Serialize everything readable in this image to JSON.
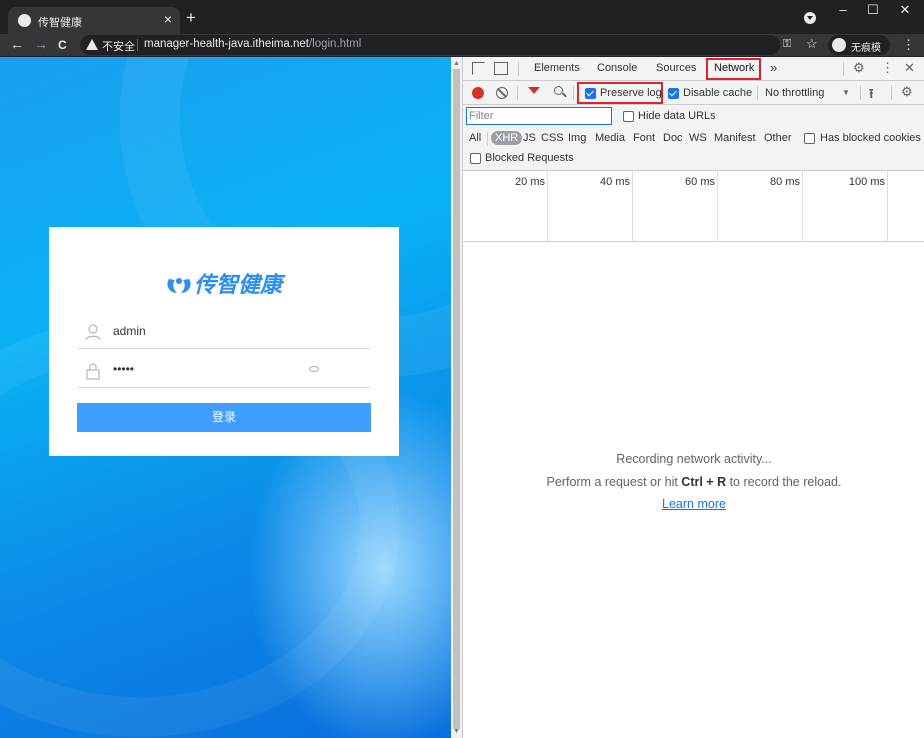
{
  "browser": {
    "tab_title": "传智健康",
    "tab_close": "×",
    "new_tab": "+",
    "window_controls": [
      "–",
      "☐",
      "✕"
    ],
    "nav": {
      "back": "←",
      "forward": "→",
      "reload": "C"
    },
    "not_secure": "不安全",
    "url_host": "manager-health-java.itheima.net",
    "url_path": "/login.html",
    "key_glyph": "⚿",
    "star_glyph": "☆",
    "incognito_label": "无痕模式",
    "menu_glyph": "⋮"
  },
  "page": {
    "brand": "传智健康",
    "username": "admin",
    "password_mask": "•••••",
    "login_button": "登录"
  },
  "devtools": {
    "panel_tabs": [
      "Elements",
      "Console",
      "Sources",
      "Network"
    ],
    "active_tab": "Network",
    "more_tabs": "»",
    "settings_glyph": "⚙",
    "kebab_glyph": "⋮",
    "close_glyph": "✕",
    "preserve_log": {
      "label": "Preserve log",
      "checked": true
    },
    "disable_cache": {
      "label": "Disable cache",
      "checked": true
    },
    "throttling": "No throttling",
    "upload_glyph": "⭱",
    "filter_placeholder": "Filter",
    "hide_data_urls": {
      "label": "Hide data URLs",
      "checked": false
    },
    "types": [
      "All",
      "XHR",
      "JS",
      "CSS",
      "Img",
      "Media",
      "Font",
      "Doc",
      "WS",
      "Manifest",
      "Other"
    ],
    "selected_type": "XHR",
    "has_blocked_cookies": {
      "label": "Has blocked cookies",
      "checked": false
    },
    "blocked_requests": {
      "label": "Blocked Requests",
      "checked": false
    },
    "timeline_ticks": [
      "20 ms",
      "40 ms",
      "60 ms",
      "80 ms",
      "100 ms"
    ],
    "empty_line1": "Recording network activity...",
    "empty_line2_pre": "Perform a request or hit ",
    "empty_line2_key": "Ctrl + R",
    "empty_line2_post": " to record the reload.",
    "learn_more": "Learn more"
  },
  "colors": {
    "highlight_box": "#e0222a",
    "primary_button": "#409eff",
    "brand_blue": "#2e8ef0",
    "record_red": "#d93025",
    "link_blue": "#1a73e8"
  }
}
